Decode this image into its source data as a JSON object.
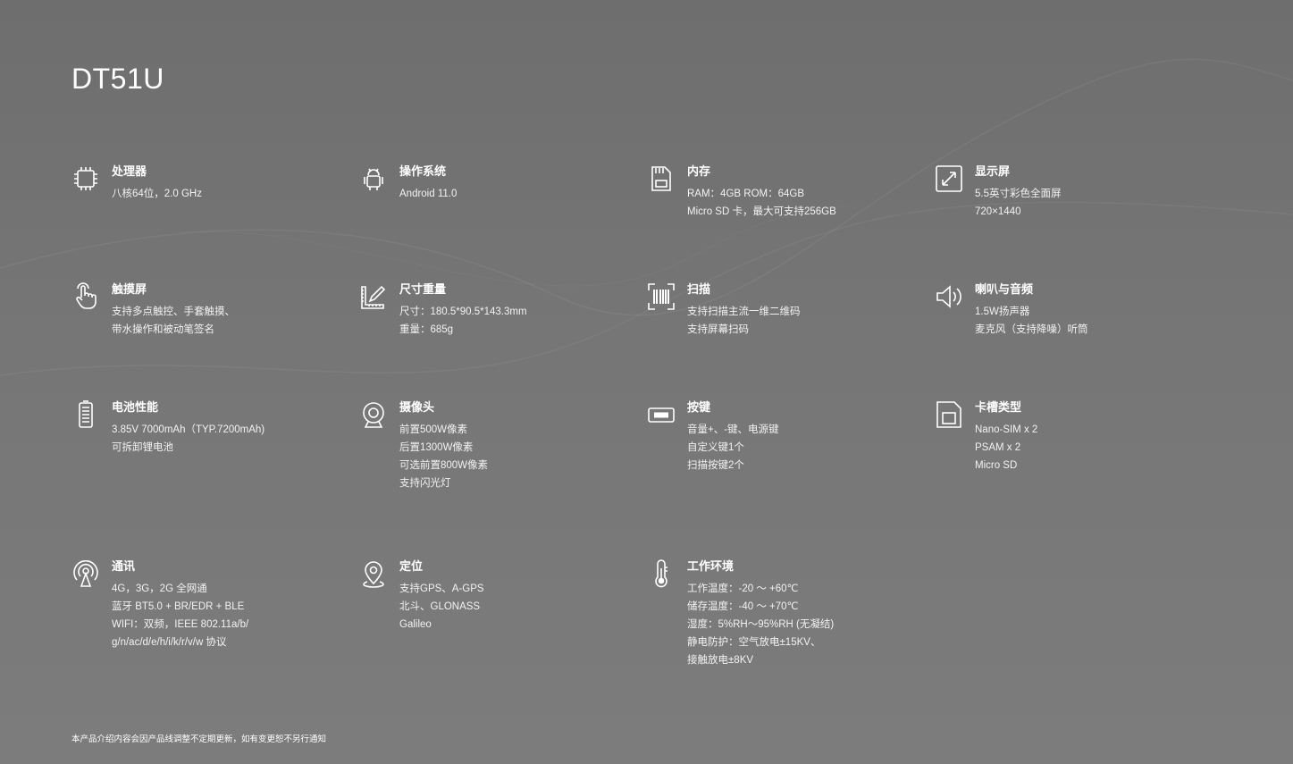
{
  "title": "DT51U",
  "specs": [
    {
      "icon": "cpu-icon",
      "label": "处理器",
      "lines": [
        "八核64位，2.0 GHz"
      ]
    },
    {
      "icon": "android-icon",
      "label": "操作系统",
      "lines": [
        "Android 11.0"
      ]
    },
    {
      "icon": "sd-card-icon",
      "label": "内存",
      "lines": [
        "RAM：4GB ROM：64GB",
        "Micro SD 卡，最大可支持256GB"
      ]
    },
    {
      "icon": "expand-screen-icon",
      "label": "显示屏",
      "lines": [
        "5.5英寸彩色全面屏",
        "720×1440"
      ]
    },
    {
      "icon": "touch-hand-icon",
      "label": "触摸屏",
      "lines": [
        "支持多点触控、手套触摸、",
        "带水操作和被动笔签名"
      ]
    },
    {
      "icon": "ruler-pencil-icon",
      "label": "尺寸重量",
      "lines": [
        "尺寸：180.5*90.5*143.3mm",
        "重量：685g"
      ]
    },
    {
      "icon": "barcode-scan-icon",
      "label": "扫描",
      "lines": [
        "支持扫描主流一维二维码",
        "支持屏幕扫码"
      ]
    },
    {
      "icon": "speaker-icon",
      "label": "喇叭与音频",
      "lines": [
        "1.5W扬声器",
        "麦克风（支持降噪）听筒"
      ]
    },
    {
      "icon": "battery-icon",
      "label": "电池性能",
      "lines": [
        "3.85V 7000mAh（TYP.7200mAh)",
        "可拆卸锂电池"
      ]
    },
    {
      "icon": "camera-icon",
      "label": "摄像头",
      "lines": [
        "前置500W像素",
        "后置1300W像素",
        "可选前置800W像素",
        "支持闪光灯"
      ]
    },
    {
      "icon": "key-button-icon",
      "label": "按键",
      "lines": [
        "音量+、-键、电源键",
        "自定义键1个",
        "扫描按键2个"
      ]
    },
    {
      "icon": "sim-card-icon",
      "label": "卡槽类型",
      "lines": [
        "Nano-SIM x 2",
        "PSAM x 2",
        "Micro SD"
      ]
    },
    {
      "icon": "signal-tower-icon",
      "label": "通讯",
      "lines": [
        "4G，3G，2G 全网通",
        "蓝牙 BT5.0 + BR/EDR + BLE",
        "WIFI：双频，IEEE 802.11a/b/",
        "g/n/ac/d/e/h/i/k/r/v/w 协议"
      ]
    },
    {
      "icon": "location-pin-icon",
      "label": "定位",
      "lines": [
        "支持GPS、A-GPS",
        "北斗、GLONASS",
        "Galileo"
      ]
    },
    {
      "icon": "thermometer-icon",
      "label": "工作环境",
      "lines": [
        "工作温度：-20 ～ +60℃",
        "储存温度：-40 ～ +70℃",
        "湿度：5%RH～95%RH (无凝结)",
        "静电防护：空气放电±15KV、",
        "接触放电±8KV"
      ]
    }
  ],
  "footer": "本产品介绍内容会因产品线调整不定期更新，如有变更恕不另行通知"
}
